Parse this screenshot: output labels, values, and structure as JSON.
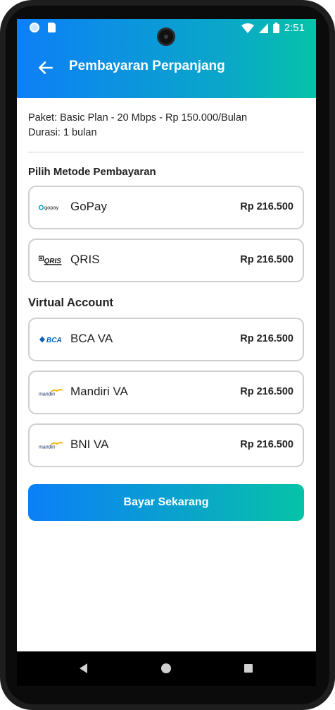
{
  "status_bar": {
    "time": "2:51",
    "icons": [
      "notification-dot-icon",
      "sd-card-icon",
      "wifi-icon",
      "signal-icon",
      "battery-icon"
    ]
  },
  "appbar": {
    "title": "Pembayaran Perpanjang",
    "back_icon": "arrow-left-icon"
  },
  "package_info": {
    "package_line": "Paket: Basic Plan - 20 Mbps - Rp 150.000/Bulan",
    "duration_line": "Durasi: 1 bulan"
  },
  "payment_section": {
    "title": "Pilih Metode Pembayaran",
    "methods": [
      {
        "name": "GoPay",
        "price": "Rp 216.500",
        "logo_text": "gopay",
        "logo": "gopay-logo"
      },
      {
        "name": "QRIS",
        "price": "Rp 216.500",
        "logo_text": "QRIS",
        "logo": "qris-logo"
      }
    ]
  },
  "va_section": {
    "title": "Virtual Account",
    "methods": [
      {
        "name": "BCA VA",
        "price": "Rp 216.500",
        "logo_text": "BCA",
        "logo": "bca-logo"
      },
      {
        "name": "Mandiri VA",
        "price": "Rp 216.500",
        "logo_text": "mandiri",
        "logo": "mandiri-logo"
      },
      {
        "name": "BNI VA",
        "price": "Rp 216.500",
        "logo_text": "mandiri",
        "logo": "mandiri-logo"
      }
    ]
  },
  "pay_button": {
    "label": "Bayar Sekarang"
  },
  "nav_bar": {
    "icons": [
      "nav-back-icon",
      "nav-home-icon",
      "nav-recents-icon"
    ]
  },
  "colors": {
    "gradient_start": "#0d7ff7",
    "gradient_end": "#05c3a8",
    "card_border": "#cfcfcf",
    "text": "#222222"
  }
}
